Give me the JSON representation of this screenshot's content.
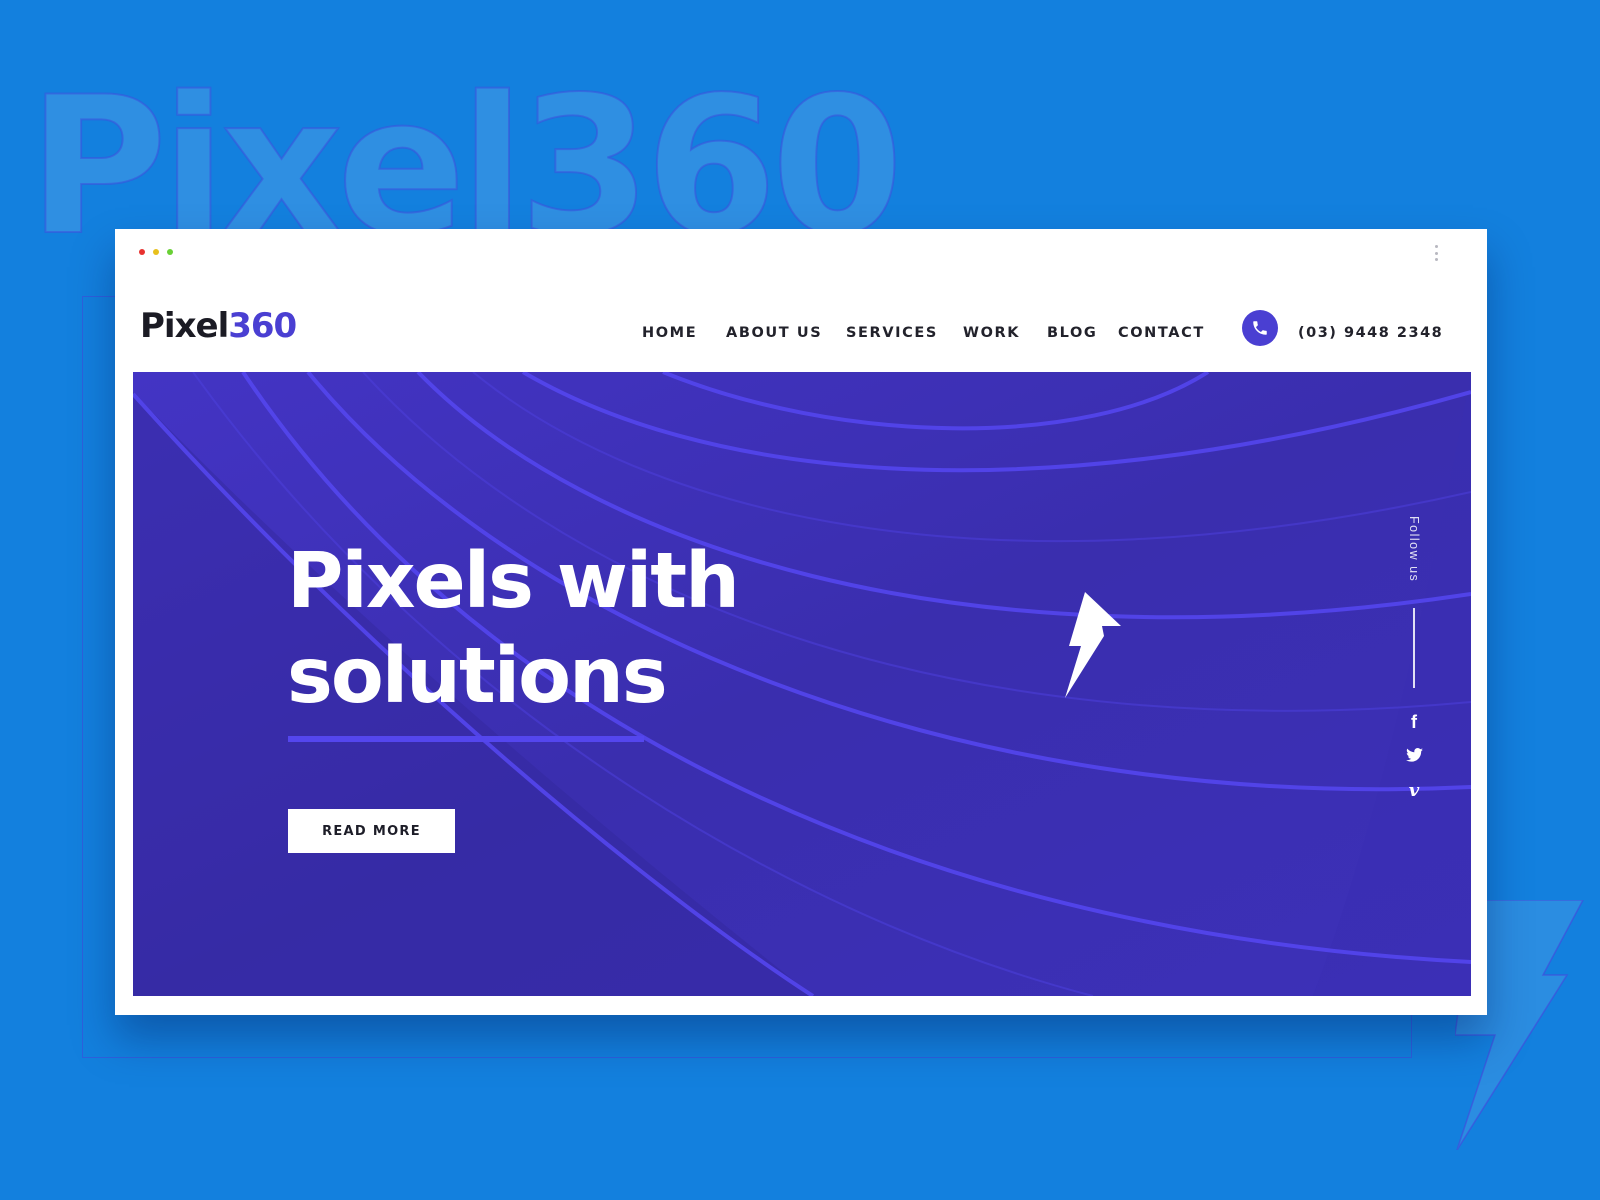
{
  "background": {
    "watermark_text": "Pixel360",
    "color": "#1380de"
  },
  "browser_window": {
    "traffic_lights": [
      "#e8322f",
      "#e8c01c",
      "#69d035"
    ],
    "menu_icon": "kebab-icon"
  },
  "header": {
    "logo": {
      "part1": "Pixel",
      "part2": "360"
    },
    "nav": [
      {
        "label": "HOME"
      },
      {
        "label": "ABOUT US"
      },
      {
        "label": "SERVICES"
      },
      {
        "label": "WORK"
      },
      {
        "label": "BLOG"
      },
      {
        "label": "CONTACT"
      }
    ],
    "phone_icon": "phone-icon",
    "phone": "(03) 9448 2348"
  },
  "hero": {
    "title_line1": "Pixels with",
    "title_line2": "solutions",
    "cta_label": "READ MORE",
    "center_icon": "lightning-bolt-icon",
    "follow_label": "Follow us",
    "social": [
      {
        "name": "facebook-icon",
        "glyph": "f"
      },
      {
        "name": "twitter-icon",
        "glyph": ""
      },
      {
        "name": "vimeo-icon",
        "glyph": "v"
      }
    ]
  },
  "colors": {
    "accent": "#4a3fd2",
    "hero_bg": "#3b2fb2",
    "hero_stripe": "#5446ee",
    "text_dark": "#22222b"
  }
}
